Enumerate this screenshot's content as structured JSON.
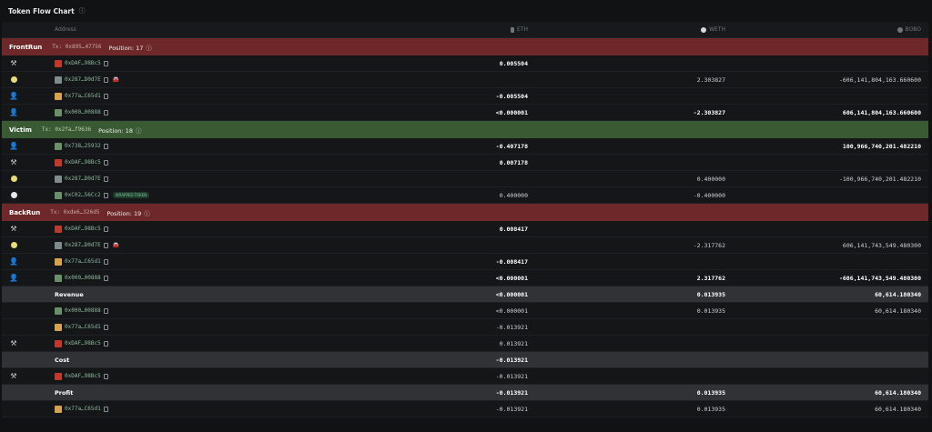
{
  "title": "Token Flow Chart",
  "title_info": "ⓘ",
  "columns": {
    "address": "Address",
    "eth": "ETH",
    "weth": "WETH",
    "bobo": "BOBO"
  },
  "sections": [
    {
      "name": "FrontRun",
      "tx_label": "Tx:",
      "tx": "0x895…47756",
      "position_label": "Position:",
      "position": "17",
      "color": "#6e2829",
      "rows": [
        {
          "icon": "hammer",
          "avatar": "red",
          "addr": "0xDAF…98Bc5",
          "tag": "",
          "car": false,
          "eth": "0.005504",
          "eth_bold": true,
          "weth": "",
          "weth_bold": false,
          "bobo": "",
          "bobo_bold": false
        },
        {
          "icon": "coin",
          "avatar": "gray",
          "addr": "0x287…D0d7E",
          "tag": "",
          "car": true,
          "eth": "",
          "eth_bold": false,
          "weth": "2.303827",
          "weth_bold": false,
          "bobo": "-606,141,804,163.660600",
          "bobo_bold": false
        },
        {
          "icon": "person",
          "avatar": "yellow",
          "addr": "0x77a…C65d1",
          "tag": "",
          "car": false,
          "eth": "-0.005504",
          "eth_bold": true,
          "weth": "",
          "weth_bold": false,
          "bobo": "",
          "bobo_bold": false
        },
        {
          "icon": "person",
          "avatar": "green",
          "addr": "0x000…00888",
          "tag": "",
          "car": false,
          "eth": "<0.000001",
          "eth_bold": true,
          "weth": "-2.303827",
          "weth_bold": true,
          "bobo": "606,141,804,163.660600",
          "bobo_bold": true
        }
      ]
    },
    {
      "name": "Victim",
      "tx_label": "Tx:",
      "tx": "0x2fa…f9636",
      "position_label": "Position:",
      "position": "18",
      "color": "#3a5a34",
      "rows": [
        {
          "icon": "person-white",
          "avatar": "green",
          "addr": "0x738…25932",
          "tag": "",
          "car": false,
          "eth": "-0.407178",
          "eth_bold": true,
          "weth": "",
          "weth_bold": false,
          "bobo": "100,966,740,201.482210",
          "bobo_bold": true
        },
        {
          "icon": "hammer",
          "avatar": "red",
          "addr": "0xDAF…98Bc5",
          "tag": "",
          "car": false,
          "eth": "0.007178",
          "eth_bold": true,
          "weth": "",
          "weth_bold": false,
          "bobo": "",
          "bobo_bold": false
        },
        {
          "icon": "coin",
          "avatar": "gray",
          "addr": "0x287…D0d7E",
          "tag": "",
          "car": false,
          "eth": "",
          "eth_bold": false,
          "weth": "0.400000",
          "weth_bold": false,
          "bobo": "-100,966,740,201.482210",
          "bobo_bold": false
        },
        {
          "icon": "coin-white",
          "avatar": "green",
          "addr": "0xC02…56Cc2",
          "tag": "WRAPPED-TOKEN",
          "car": false,
          "eth": "0.400000",
          "eth_bold": false,
          "weth": "-0.400000",
          "weth_bold": false,
          "bobo": "",
          "bobo_bold": false
        }
      ]
    },
    {
      "name": "BackRun",
      "tx_label": "Tx:",
      "tx": "0xde6…326d5",
      "position_label": "Position:",
      "position": "19",
      "color": "#6e2829",
      "rows": [
        {
          "icon": "hammer",
          "avatar": "red",
          "addr": "0xDAF…98Bc5",
          "tag": "",
          "car": false,
          "eth": "0.008417",
          "eth_bold": true,
          "weth": "",
          "weth_bold": false,
          "bobo": "",
          "bobo_bold": false
        },
        {
          "icon": "coin",
          "avatar": "gray",
          "addr": "0x287…D0d7E",
          "tag": "",
          "car": true,
          "eth": "",
          "eth_bold": false,
          "weth": "-2.317762",
          "weth_bold": false,
          "bobo": "606,141,743,549.480300",
          "bobo_bold": false
        },
        {
          "icon": "person",
          "avatar": "yellow",
          "addr": "0x77a…C65d1",
          "tag": "",
          "car": false,
          "eth": "-0.008417",
          "eth_bold": true,
          "weth": "",
          "weth_bold": false,
          "bobo": "",
          "bobo_bold": false
        },
        {
          "icon": "person",
          "avatar": "green",
          "addr": "0x000…00888",
          "tag": "",
          "car": false,
          "eth": "<0.000001",
          "eth_bold": true,
          "weth": "2.317762",
          "weth_bold": true,
          "bobo": "-606,141,743,549.480300",
          "bobo_bold": true
        }
      ]
    }
  ],
  "summaries": [
    {
      "label": "Revenue",
      "eth": "<0.000001",
      "weth": "0.013935",
      "bobo": "60,614.180340",
      "rows": [
        {
          "icon": "",
          "avatar": "green",
          "addr": "0x000…00888",
          "eth": "<0.000001",
          "weth": "0.013935",
          "bobo": "60,614.180340"
        },
        {
          "icon": "",
          "avatar": "yellow",
          "addr": "0x77a…C65d1",
          "eth": "-0.013921",
          "weth": "",
          "bobo": ""
        },
        {
          "icon": "hammer",
          "avatar": "red",
          "addr": "0xDAF…98Bc5",
          "eth": "0.013921",
          "weth": "",
          "bobo": ""
        }
      ]
    },
    {
      "label": "Cost",
      "eth": "-0.013921",
      "weth": "",
      "bobo": "",
      "rows": [
        {
          "icon": "hammer",
          "avatar": "red",
          "addr": "0xDAF…98Bc5",
          "eth": "-0.013921",
          "weth": "",
          "bobo": ""
        }
      ]
    },
    {
      "label": "Profit",
      "eth": "-0.013921",
      "weth": "0.013935",
      "bobo": "60,614.180340",
      "rows": [
        {
          "icon": "",
          "avatar": "yellow",
          "addr": "0x77a…C65d1",
          "eth": "-0.013921",
          "weth": "0.013935",
          "bobo": "60,614.180340"
        }
      ]
    }
  ],
  "colors": {
    "background": "#101214",
    "frontrun": "#6e2829",
    "victim": "#3a5a34",
    "summary": "#303236",
    "address": "#8fb8a0"
  }
}
